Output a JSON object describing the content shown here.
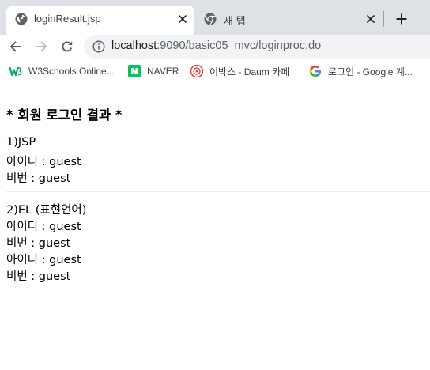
{
  "tabs": [
    {
      "title": "loginResult.jsp",
      "icon": "globe-icon",
      "active": true
    },
    {
      "title": "새 탭",
      "icon": "chrome-icon",
      "active": false
    }
  ],
  "toolbar": {
    "url_host": "localhost",
    "url_path": ":9090/basic05_mvc/loginproc.do"
  },
  "bookmarks": [
    {
      "label": "W3Schools Online...",
      "icon": "w3schools-icon",
      "color": "#04aa6d"
    },
    {
      "label": "NAVER",
      "icon": "naver-icon",
      "color": "#03c75a"
    },
    {
      "label": "이박스 - Daum 카페",
      "icon": "daum-cafe-icon",
      "color": "#e8453c"
    },
    {
      "label": "로그인 - Google 계...",
      "icon": "google-icon",
      "color": "#4285f4"
    }
  ],
  "page": {
    "heading": "* 회원 로그인 결과 *",
    "section1_title": "1)JSP",
    "section1_id": "아이디 : guest",
    "section1_pw": "비번 : guest",
    "section2_title": "2)EL (표현언어)",
    "section2_id_a": "아이디 : guest",
    "section2_pw_a": "비번 : guest",
    "section2_id_b": "아이디 : guest",
    "section2_pw_b": "비번 : guest"
  }
}
